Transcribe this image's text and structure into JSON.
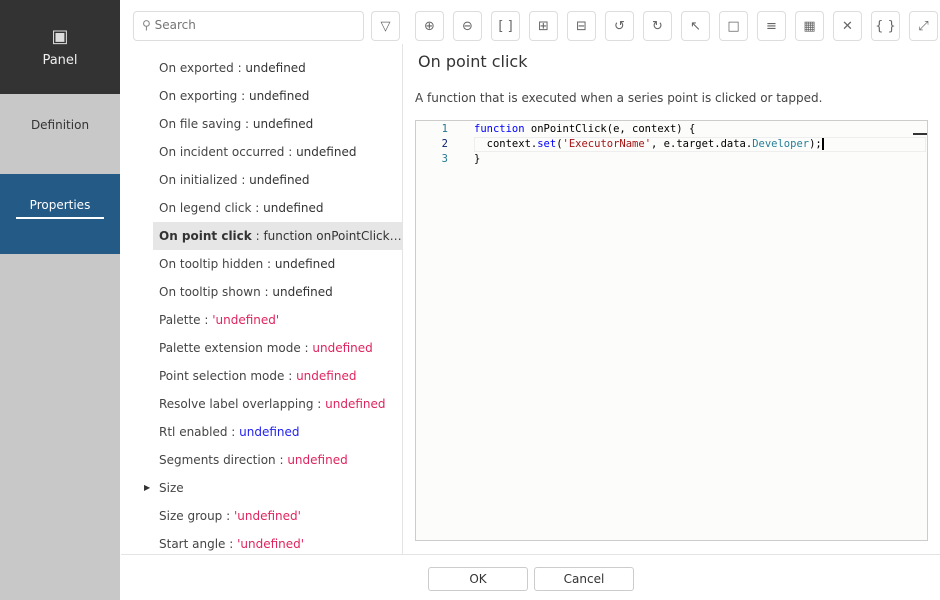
{
  "sidebar": {
    "panel_label": "Panel",
    "definition_label": "Definition",
    "properties_label": "Properties"
  },
  "search": {
    "placeholder": "Search"
  },
  "toolbar": [
    "zoom-in",
    "zoom-out",
    "fit",
    "expand-all",
    "collapse-all",
    "undo",
    "redo",
    "select",
    "comment",
    "list",
    "table",
    "close",
    "braces",
    "fullscreen"
  ],
  "properties": [
    {
      "label": "On exported",
      "value": "undefined",
      "color": "dark"
    },
    {
      "label": "On exporting",
      "value": "undefined",
      "color": "dark"
    },
    {
      "label": "On file saving",
      "value": "undefined",
      "color": "dark"
    },
    {
      "label": "On incident occurred",
      "value": "undefined",
      "color": "dark"
    },
    {
      "label": "On initialized",
      "value": "undefined",
      "color": "dark"
    },
    {
      "label": "On legend click",
      "value": "undefined",
      "color": "dark"
    },
    {
      "label": "On point click",
      "value": "function onPointClick(e,…",
      "color": "dark",
      "selected": true
    },
    {
      "label": "On tooltip hidden",
      "value": "undefined",
      "color": "dark"
    },
    {
      "label": "On tooltip shown",
      "value": "undefined",
      "color": "dark"
    },
    {
      "label": "Palette",
      "value": "'undefined'",
      "color": "red"
    },
    {
      "label": "Palette extension mode",
      "value": "undefined",
      "color": "red"
    },
    {
      "label": "Point selection mode",
      "value": "undefined",
      "color": "red"
    },
    {
      "label": "Resolve label overlapping",
      "value": "undefined",
      "color": "red"
    },
    {
      "label": "Rtl enabled",
      "value": "undefined",
      "color": "blue"
    },
    {
      "label": "Segments direction",
      "value": "undefined",
      "color": "red"
    },
    {
      "label": "Size",
      "expandable": true
    },
    {
      "label": "Size group",
      "value": "'undefined'",
      "color": "red"
    },
    {
      "label": "Start angle",
      "value": "'undefined'",
      "color": "red"
    }
  ],
  "detail": {
    "title": "On point click",
    "description": "A function that is executed when a series point is clicked or tapped.",
    "line_numbers": [
      "1",
      "2",
      "3"
    ],
    "code": {
      "l1_kw": "function",
      "l1_rest": " onPointClick(e, context) {",
      "l2_a": "  context.",
      "l2_set": "set",
      "l2_b": "(",
      "l2_str": "'ExecutorName'",
      "l2_c": ", e.target.data.",
      "l2_dev": "Developer",
      "l2_d": ");",
      "l3": "}"
    }
  },
  "footer": {
    "ok_label": "OK",
    "cancel_label": "Cancel"
  }
}
